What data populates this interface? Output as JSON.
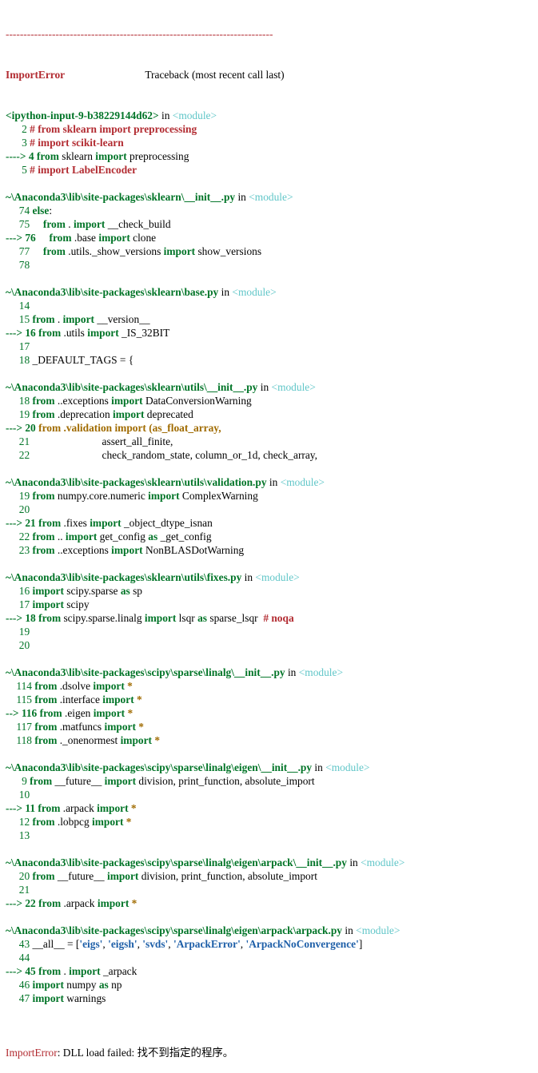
{
  "header": {
    "rule": "---------------------------------------------------------------------------",
    "error_name": "ImportError",
    "traceback_label": "Traceback (most recent call last)"
  },
  "frames": [
    {
      "path": "<ipython-input-9-b38229144d62>",
      "in": "in",
      "module": "<module>",
      "lines": [
        {
          "marker": "      ",
          "num": "2",
          "tokens": [
            {
              "t": "# from sklearn import preprocessing",
              "c": "cmt"
            }
          ]
        },
        {
          "marker": "      ",
          "num": "3",
          "tokens": [
            {
              "t": "# import scikit-learn",
              "c": "cmt"
            }
          ]
        },
        {
          "marker": "----> ",
          "num": "4",
          "tokens": [
            {
              "t": "from",
              "c": "kw"
            },
            {
              "t": " sklearn ",
              "c": ""
            },
            {
              "t": "import",
              "c": "kw"
            },
            {
              "t": " preprocessing",
              "c": ""
            }
          ]
        },
        {
          "marker": "      ",
          "num": "5",
          "tokens": [
            {
              "t": "# import LabelEncoder",
              "c": "cmt"
            }
          ]
        }
      ]
    },
    {
      "path": "~\\Anaconda3\\lib\\site-packages\\sklearn\\__init__.py",
      "in": "in",
      "module": "<module>",
      "lines": [
        {
          "marker": "     ",
          "num": "74",
          "tokens": [
            {
              "t": "else",
              "c": "kw"
            },
            {
              "t": ":",
              "c": ""
            }
          ]
        },
        {
          "marker": "     ",
          "num": "75",
          "tokens": [
            {
              "t": "    from",
              "c": "kw"
            },
            {
              "t": " . ",
              "c": ""
            },
            {
              "t": "import",
              "c": "kw"
            },
            {
              "t": " __check_build",
              "c": ""
            }
          ]
        },
        {
          "marker": "---> ",
          "num": "76",
          "tokens": [
            {
              "t": "    from",
              "c": "kw"
            },
            {
              "t": " .base ",
              "c": ""
            },
            {
              "t": "import",
              "c": "kw"
            },
            {
              "t": " clone",
              "c": ""
            }
          ]
        },
        {
          "marker": "     ",
          "num": "77",
          "tokens": [
            {
              "t": "    from",
              "c": "kw"
            },
            {
              "t": " .utils._show_versions ",
              "c": ""
            },
            {
              "t": "import",
              "c": "kw"
            },
            {
              "t": " show_versions",
              "c": ""
            }
          ]
        },
        {
          "marker": "     ",
          "num": "78",
          "tokens": []
        }
      ]
    },
    {
      "path": "~\\Anaconda3\\lib\\site-packages\\sklearn\\base.py",
      "in": "in",
      "module": "<module>",
      "lines": [
        {
          "marker": "     ",
          "num": "14",
          "tokens": []
        },
        {
          "marker": "     ",
          "num": "15",
          "tokens": [
            {
              "t": "from",
              "c": "kw"
            },
            {
              "t": " . ",
              "c": ""
            },
            {
              "t": "import",
              "c": "kw"
            },
            {
              "t": " __version__",
              "c": ""
            }
          ]
        },
        {
          "marker": "---> ",
          "num": "16",
          "tokens": [
            {
              "t": "from",
              "c": "kw"
            },
            {
              "t": " .utils ",
              "c": ""
            },
            {
              "t": "import",
              "c": "kw"
            },
            {
              "t": " _IS_32BIT",
              "c": ""
            }
          ]
        },
        {
          "marker": "     ",
          "num": "17",
          "tokens": []
        },
        {
          "marker": "     ",
          "num": "18",
          "tokens": [
            {
              "t": "_DEFAULT_TAGS = {",
              "c": ""
            }
          ]
        }
      ]
    },
    {
      "path": "~\\Anaconda3\\lib\\site-packages\\sklearn\\utils\\__init__.py",
      "in": "in",
      "module": "<module>",
      "lines": [
        {
          "marker": "     ",
          "num": "18",
          "tokens": [
            {
              "t": "from",
              "c": "kw"
            },
            {
              "t": " ..exceptions ",
              "c": ""
            },
            {
              "t": "import",
              "c": "kw"
            },
            {
              "t": " DataConversionWarning",
              "c": ""
            }
          ]
        },
        {
          "marker": "     ",
          "num": "19",
          "tokens": [
            {
              "t": "from",
              "c": "kw"
            },
            {
              "t": " .deprecation ",
              "c": ""
            },
            {
              "t": "import",
              "c": "kw"
            },
            {
              "t": " deprecated",
              "c": ""
            }
          ]
        },
        {
          "marker": "---> ",
          "num": "20",
          "tokens": [
            {
              "t": "from .validation import (as_float_array,",
              "c": "hl"
            }
          ]
        },
        {
          "marker": "     ",
          "num": "21",
          "tokens": [
            {
              "t": "                          assert_all_finite,",
              "c": ""
            }
          ]
        },
        {
          "marker": "     ",
          "num": "22",
          "tokens": [
            {
              "t": "                          check_random_state, column_or_1d, check_array,",
              "c": ""
            }
          ]
        }
      ]
    },
    {
      "path": "~\\Anaconda3\\lib\\site-packages\\sklearn\\utils\\validation.py",
      "in": "in",
      "module": "<module>",
      "lines": [
        {
          "marker": "     ",
          "num": "19",
          "tokens": [
            {
              "t": "from",
              "c": "kw"
            },
            {
              "t": " numpy.core.numeric ",
              "c": ""
            },
            {
              "t": "import",
              "c": "kw"
            },
            {
              "t": " ComplexWarning",
              "c": ""
            }
          ]
        },
        {
          "marker": "     ",
          "num": "20",
          "tokens": []
        },
        {
          "marker": "---> ",
          "num": "21",
          "tokens": [
            {
              "t": "from",
              "c": "kw"
            },
            {
              "t": " .fixes ",
              "c": ""
            },
            {
              "t": "import",
              "c": "kw"
            },
            {
              "t": " _object_dtype_isnan",
              "c": ""
            }
          ]
        },
        {
          "marker": "     ",
          "num": "22",
          "tokens": [
            {
              "t": "from",
              "c": "kw"
            },
            {
              "t": " .. ",
              "c": ""
            },
            {
              "t": "import",
              "c": "kw"
            },
            {
              "t": " get_config ",
              "c": ""
            },
            {
              "t": "as",
              "c": "kw"
            },
            {
              "t": " _get_config",
              "c": ""
            }
          ]
        },
        {
          "marker": "     ",
          "num": "23",
          "tokens": [
            {
              "t": "from",
              "c": "kw"
            },
            {
              "t": " ..exceptions ",
              "c": ""
            },
            {
              "t": "import",
              "c": "kw"
            },
            {
              "t": " NonBLASDotWarning",
              "c": ""
            }
          ]
        }
      ]
    },
    {
      "path": "~\\Anaconda3\\lib\\site-packages\\sklearn\\utils\\fixes.py",
      "in": "in",
      "module": "<module>",
      "lines": [
        {
          "marker": "     ",
          "num": "16",
          "tokens": [
            {
              "t": "import",
              "c": "kw"
            },
            {
              "t": " scipy.sparse ",
              "c": ""
            },
            {
              "t": "as",
              "c": "kw"
            },
            {
              "t": " sp",
              "c": ""
            }
          ]
        },
        {
          "marker": "     ",
          "num": "17",
          "tokens": [
            {
              "t": "import",
              "c": "kw"
            },
            {
              "t": " scipy",
              "c": ""
            }
          ]
        },
        {
          "marker": "---> ",
          "num": "18",
          "tokens": [
            {
              "t": "from",
              "c": "kw"
            },
            {
              "t": " scipy.sparse.linalg ",
              "c": ""
            },
            {
              "t": "import",
              "c": "kw"
            },
            {
              "t": " lsqr ",
              "c": ""
            },
            {
              "t": "as",
              "c": "kw"
            },
            {
              "t": " sparse_lsqr  ",
              "c": ""
            },
            {
              "t": "# noqa",
              "c": "cmt"
            }
          ]
        },
        {
          "marker": "     ",
          "num": "19",
          "tokens": []
        },
        {
          "marker": "     ",
          "num": "20",
          "tokens": []
        }
      ]
    },
    {
      "path": "~\\Anaconda3\\lib\\site-packages\\scipy\\sparse\\linalg\\__init__.py",
      "in": "in",
      "module": "<module>",
      "lines": [
        {
          "marker": "    ",
          "num": "114",
          "tokens": [
            {
              "t": "from",
              "c": "kw"
            },
            {
              "t": " .dsolve ",
              "c": ""
            },
            {
              "t": "import",
              "c": "kw"
            },
            {
              "t": " *",
              "c": "hl"
            }
          ]
        },
        {
          "marker": "    ",
          "num": "115",
          "tokens": [
            {
              "t": "from",
              "c": "kw"
            },
            {
              "t": " .interface ",
              "c": ""
            },
            {
              "t": "import",
              "c": "kw"
            },
            {
              "t": " *",
              "c": "hl"
            }
          ]
        },
        {
          "marker": "--> ",
          "num": "116",
          "tokens": [
            {
              "t": "from",
              "c": "kw"
            },
            {
              "t": " .eigen ",
              "c": ""
            },
            {
              "t": "import",
              "c": "kw"
            },
            {
              "t": " *",
              "c": "hl"
            }
          ]
        },
        {
          "marker": "    ",
          "num": "117",
          "tokens": [
            {
              "t": "from",
              "c": "kw"
            },
            {
              "t": " .matfuncs ",
              "c": ""
            },
            {
              "t": "import",
              "c": "kw"
            },
            {
              "t": " *",
              "c": "hl"
            }
          ]
        },
        {
          "marker": "    ",
          "num": "118",
          "tokens": [
            {
              "t": "from",
              "c": "kw"
            },
            {
              "t": " ._onenormest ",
              "c": ""
            },
            {
              "t": "import",
              "c": "kw"
            },
            {
              "t": " *",
              "c": "hl"
            }
          ]
        }
      ]
    },
    {
      "path": "~\\Anaconda3\\lib\\site-packages\\scipy\\sparse\\linalg\\eigen\\__init__.py",
      "in": "in",
      "module": "<module>",
      "lines": [
        {
          "marker": "      ",
          "num": "9",
          "tokens": [
            {
              "t": "from",
              "c": "kw"
            },
            {
              "t": " __future__ ",
              "c": ""
            },
            {
              "t": "import",
              "c": "kw"
            },
            {
              "t": " division, print_function, absolute_import",
              "c": ""
            }
          ]
        },
        {
          "marker": "     ",
          "num": "10",
          "tokens": []
        },
        {
          "marker": "---> ",
          "num": "11",
          "tokens": [
            {
              "t": "from",
              "c": "kw"
            },
            {
              "t": " .arpack ",
              "c": ""
            },
            {
              "t": "import",
              "c": "kw"
            },
            {
              "t": " *",
              "c": "hl"
            }
          ]
        },
        {
          "marker": "     ",
          "num": "12",
          "tokens": [
            {
              "t": "from",
              "c": "kw"
            },
            {
              "t": " .lobpcg ",
              "c": ""
            },
            {
              "t": "import",
              "c": "kw"
            },
            {
              "t": " *",
              "c": "hl"
            }
          ]
        },
        {
          "marker": "     ",
          "num": "13",
          "tokens": []
        }
      ]
    },
    {
      "path": "~\\Anaconda3\\lib\\site-packages\\scipy\\sparse\\linalg\\eigen\\arpack\\__init__.py",
      "in": "in",
      "module": "<module>",
      "lines": [
        {
          "marker": "     ",
          "num": "20",
          "tokens": [
            {
              "t": "from",
              "c": "kw"
            },
            {
              "t": " __future__ ",
              "c": ""
            },
            {
              "t": "import",
              "c": "kw"
            },
            {
              "t": " division, print_function, absolute_import",
              "c": ""
            }
          ]
        },
        {
          "marker": "     ",
          "num": "21",
          "tokens": []
        },
        {
          "marker": "---> ",
          "num": "22",
          "tokens": [
            {
              "t": "from",
              "c": "kw"
            },
            {
              "t": " .arpack ",
              "c": ""
            },
            {
              "t": "import",
              "c": "kw"
            },
            {
              "t": " *",
              "c": "hl"
            }
          ]
        }
      ]
    },
    {
      "path": "~\\Anaconda3\\lib\\site-packages\\scipy\\sparse\\linalg\\eigen\\arpack\\arpack.py",
      "in": "in",
      "module": "<module>",
      "lines": [
        {
          "marker": "     ",
          "num": "43",
          "tokens": [
            {
              "t": "__all__ = [",
              "c": ""
            },
            {
              "t": "'eigs'",
              "c": "str"
            },
            {
              "t": ", ",
              "c": ""
            },
            {
              "t": "'eigsh'",
              "c": "str"
            },
            {
              "t": ", ",
              "c": ""
            },
            {
              "t": "'svds'",
              "c": "str"
            },
            {
              "t": ", ",
              "c": ""
            },
            {
              "t": "'ArpackError'",
              "c": "str"
            },
            {
              "t": ", ",
              "c": ""
            },
            {
              "t": "'ArpackNoConvergence'",
              "c": "str"
            },
            {
              "t": "]",
              "c": ""
            }
          ]
        },
        {
          "marker": "     ",
          "num": "44",
          "tokens": []
        },
        {
          "marker": "---> ",
          "num": "45",
          "tokens": [
            {
              "t": "from",
              "c": "kw"
            },
            {
              "t": " . ",
              "c": ""
            },
            {
              "t": "import",
              "c": "kw"
            },
            {
              "t": " _arpack",
              "c": ""
            }
          ]
        },
        {
          "marker": "     ",
          "num": "46",
          "tokens": [
            {
              "t": "import",
              "c": "kw"
            },
            {
              "t": " numpy ",
              "c": ""
            },
            {
              "t": "as",
              "c": "kw"
            },
            {
              "t": " np",
              "c": ""
            }
          ]
        },
        {
          "marker": "     ",
          "num": "47",
          "tokens": [
            {
              "t": "import",
              "c": "kw"
            },
            {
              "t": " warnings",
              "c": ""
            }
          ]
        }
      ]
    }
  ],
  "footer": {
    "error_name": "ImportError",
    "message": ": DLL load failed: 找不到指定的程序。"
  },
  "colors": {
    "error": "#b22b31",
    "keyword": "#007427",
    "module": "#60c6c8",
    "highlight": "#a06b00",
    "string": "#1e5fa8"
  }
}
